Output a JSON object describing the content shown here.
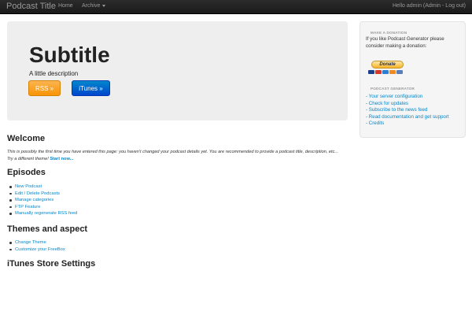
{
  "navbar": {
    "brand": "Podcast Title",
    "home": "Home",
    "archive": "Archive",
    "user_text": "Hello admin (Admin - Log out)"
  },
  "hero": {
    "title": "Subtitle",
    "description": "A little description",
    "rss_button": "RSS »",
    "itunes_button": "iTunes »"
  },
  "welcome": {
    "title": "Welcome",
    "text": "This is possibly the first time you have entered this page: you haven't changed your podcast details yet. You are recommended to provide a podcast title, description, etc... Try a different theme!",
    "link": "Start now..."
  },
  "episodes": {
    "title": "Episodes",
    "items": [
      "New Podcast",
      "Edit / Delete Podcasts",
      "Manage categories",
      "FTP Feature",
      "Manually regenerate RSS feed"
    ]
  },
  "themes": {
    "title": "Themes and aspect",
    "items": [
      "Change Theme",
      "Customize your FreeBox"
    ]
  },
  "itunes": {
    "title": "iTunes Store Settings"
  },
  "sidebar": {
    "donation_header": "MAKE A DONATION",
    "donation_text": "If you like Podcast Generator please consider making a donation:",
    "donate_button": "Donate",
    "pg_header": "PODCAST GENERATOR",
    "links": [
      "- Your server configuration",
      "- Check for updates",
      "- Subscribe to the news feed",
      "- Read documentation and get support",
      "- Credits"
    ]
  },
  "colors": {
    "link": "#0088cc",
    "rss": "#f89406",
    "itunes": "#0044cc",
    "navbar": "#1b1b1b"
  }
}
